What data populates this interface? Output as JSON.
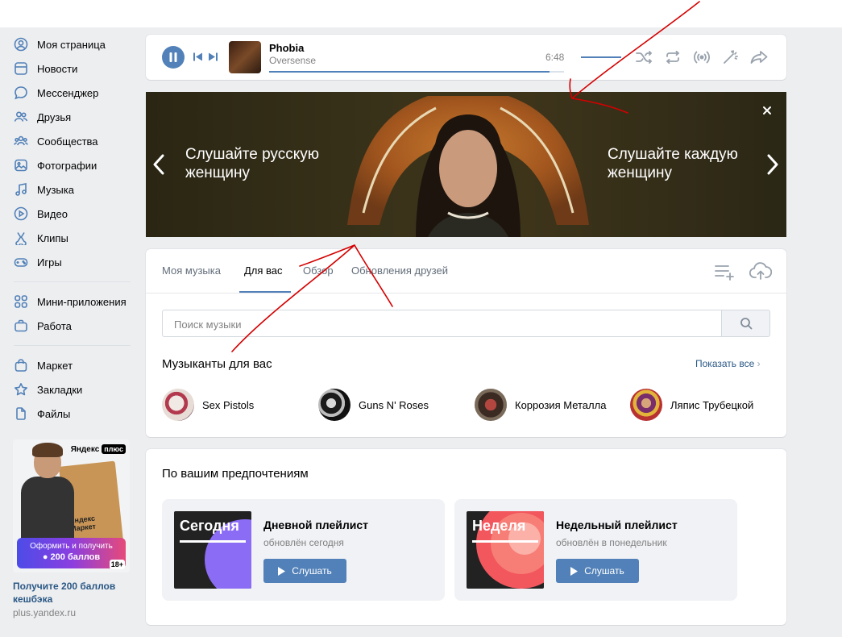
{
  "sidebar": {
    "items": [
      {
        "label": "Моя страница",
        "icon": "user-circle-icon"
      },
      {
        "label": "Новости",
        "icon": "news-icon"
      },
      {
        "label": "Мессенджер",
        "icon": "message-icon"
      },
      {
        "label": "Друзья",
        "icon": "friends-icon"
      },
      {
        "label": "Сообщества",
        "icon": "communities-icon"
      },
      {
        "label": "Фотографии",
        "icon": "photo-icon"
      },
      {
        "label": "Музыка",
        "icon": "music-note-icon"
      },
      {
        "label": "Видео",
        "icon": "video-play-icon"
      },
      {
        "label": "Клипы",
        "icon": "clips-icon"
      },
      {
        "label": "Игры",
        "icon": "gamepad-icon"
      }
    ],
    "items2": [
      {
        "label": "Мини-приложения",
        "icon": "apps-grid-icon"
      },
      {
        "label": "Работа",
        "icon": "briefcase-icon"
      }
    ],
    "items3": [
      {
        "label": "Маркет",
        "icon": "market-bag-icon"
      },
      {
        "label": "Закладки",
        "icon": "star-icon"
      },
      {
        "label": "Файлы",
        "icon": "file-icon"
      }
    ],
    "ad": {
      "brand": "Яндекс",
      "brand_tag": "плюс",
      "box_text": "Яндекс Маркет",
      "cta_line1": "Оформить и получить",
      "cta_line2": "200 баллов",
      "age": "18+",
      "title": "Получите 200 баллов кешбэка",
      "url": "plus.yandex.ru"
    }
  },
  "player": {
    "title": "Phobia",
    "artist": "Oversense",
    "time": "6:48",
    "progress": 0.95
  },
  "banner": {
    "left_text": "Слушайте русскую женщину",
    "right_text": "Слушайте каждую женщину"
  },
  "music": {
    "tabs": [
      "Моя музыка",
      "Для вас",
      "Обзор",
      "Обновления друзей"
    ],
    "active_tab": 1,
    "search_placeholder": "Поиск музыки",
    "section_title": "Музыканты для вас",
    "show_all": "Показать все",
    "artists": [
      {
        "name": "Sex Pistols"
      },
      {
        "name": "Guns N' Roses"
      },
      {
        "name": "Коррозия Металла"
      },
      {
        "name": "Ляпис Трубецкой"
      }
    ]
  },
  "prefs": {
    "title": "По вашим предпочтениям",
    "playlists": [
      {
        "cover": "Сегодня",
        "name": "Дневной плейлист",
        "sub": "обновлён сегодня",
        "button": "Слушать",
        "accent": "#8b6cf5"
      },
      {
        "cover": "Неделя",
        "name": "Недельный плейлист",
        "sub": "обновлён в понедельник",
        "button": "Слушать",
        "accent": "#f2575e"
      }
    ]
  },
  "colors": {
    "accent": "#5181b8",
    "link": "#2a5885",
    "annotation": "#d40000"
  }
}
